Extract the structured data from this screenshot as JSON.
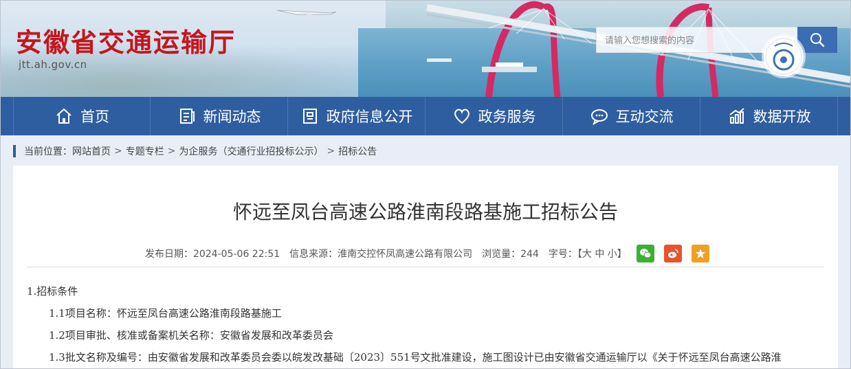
{
  "site": {
    "title": "安徽省交通运输厅",
    "url": "jtt.ah.gov.cn"
  },
  "search": {
    "placeholder": "请输入您想搜索的内容"
  },
  "nav": {
    "items": [
      {
        "label": "首页",
        "icon": "home-icon"
      },
      {
        "label": "新闻动态",
        "icon": "news-icon"
      },
      {
        "label": "政府信息公开",
        "icon": "info-icon"
      },
      {
        "label": "政务服务",
        "icon": "heart-icon"
      },
      {
        "label": "互动交流",
        "icon": "chat-icon"
      },
      {
        "label": "数据开放",
        "icon": "data-chart-icon"
      }
    ]
  },
  "breadcrumb": {
    "prefix": "当前位置：",
    "items": [
      "网站首页",
      "专题专栏",
      "为企服务（交通行业招投标公示）",
      "招标公告"
    ],
    "sep": ">"
  },
  "article": {
    "title": "怀远至凤台高速公路淮南段路基施工招标公告",
    "publish_label": "发布日期：",
    "publish_date": "2024-05-06 22:51",
    "source_label": "信息来源：",
    "source": "淮南交控怀凤高速公路有限公司",
    "views_label": "浏览量：",
    "views": "244",
    "fontsize_label": "字号：",
    "fontsize_options": "【大 中 小】",
    "paragraphs": [
      "1.招标条件",
      "1.1项目名称：怀远至凤台高速公路淮南段路基施工",
      "1.2项目审批、核准或备案机关名称：安徽省发展和改革委员会",
      "1.3批文名称及编号：由安徽省发展和改革委员会委以皖发改基础〔2023〕551号文批准建设，施工图设计已由安徽省交通运输厅以《关于怀远至凤台高速公路淮"
    ]
  },
  "colors": {
    "brand_red": "#c5161d",
    "nav_blue": "#2e5e9f",
    "wechat": "#3cb034",
    "weibo": "#e8532b",
    "favorite": "#f0a020"
  }
}
